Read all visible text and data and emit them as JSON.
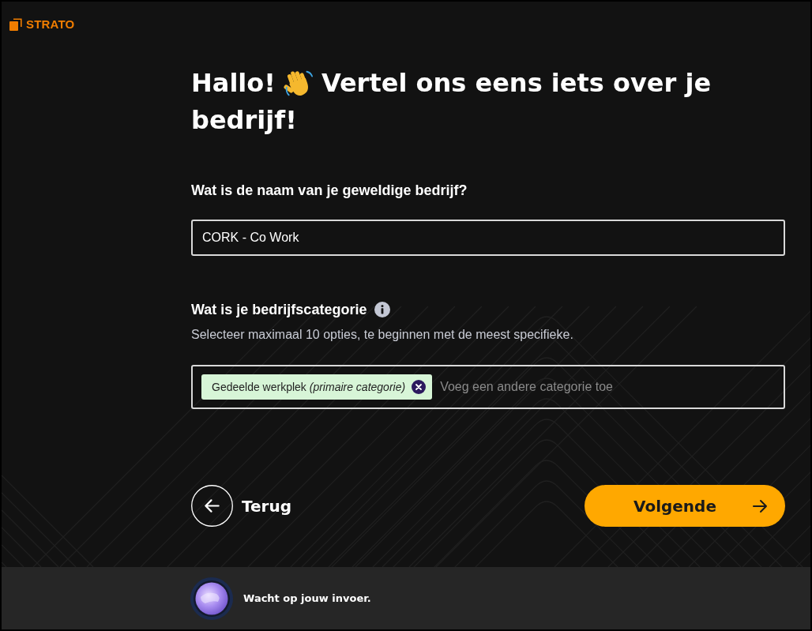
{
  "logo": {
    "text": "STRATO"
  },
  "heading": {
    "greeting": "Hallo!",
    "lines": [
      "Vertel ons eens iets over je",
      "bedrijf!"
    ]
  },
  "name_field": {
    "label": "Wat is de naam van je geweldige bedrijf?",
    "value": "CORK - Co Work"
  },
  "category_field": {
    "label": "Wat is je bedrijfscategorie",
    "hint": "Selecteer maximaal 10 opties, te beginnen met de meest specifieke.",
    "tags": [
      {
        "text": "Gedeelde werkplek *(primaire categorie)*"
      }
    ],
    "placeholder": "Voeg een andere categorie toe"
  },
  "buttons": {
    "back": "Terug",
    "next": "Volgende"
  },
  "status_bar": {
    "text": "Wacht op jouw invoer."
  }
}
